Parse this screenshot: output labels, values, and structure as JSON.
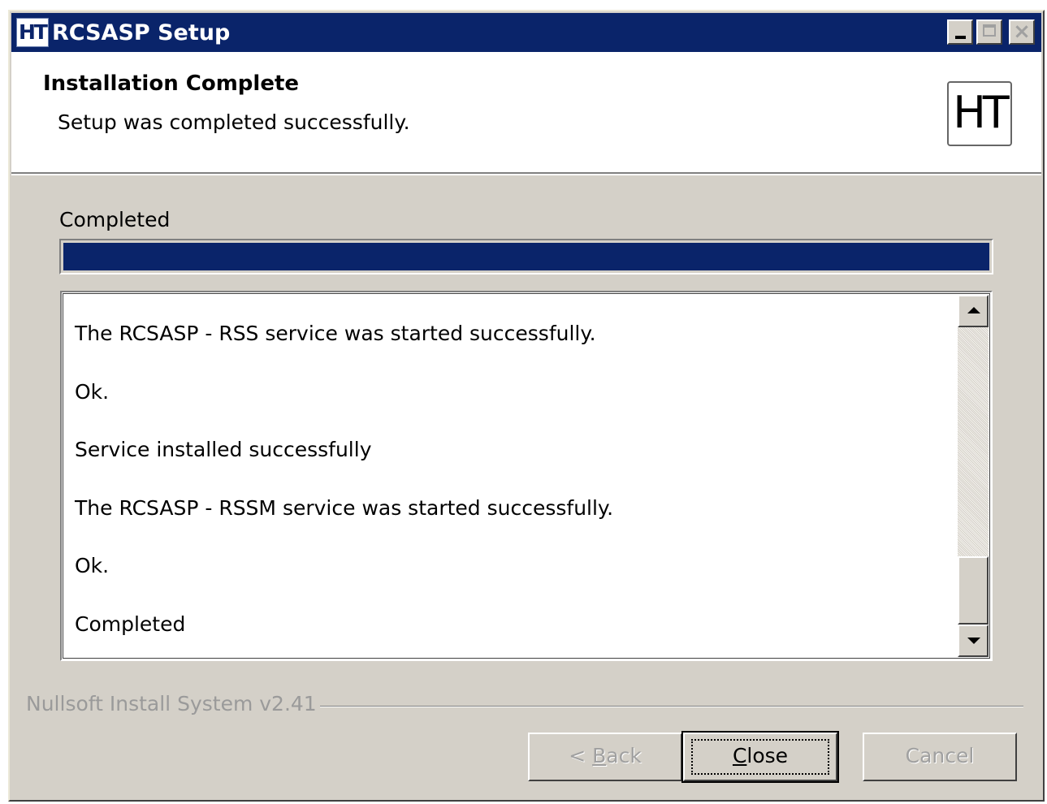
{
  "window": {
    "title": "RCSASP Setup",
    "icon_text": "HT",
    "controls": {
      "minimize": "minimize-icon",
      "maximize": "maximize-icon",
      "close": "close-icon"
    }
  },
  "header": {
    "title": "Installation Complete",
    "subtitle": "Setup was completed successfully.",
    "logo_text": "HT"
  },
  "status": {
    "label": "Completed",
    "progress_percent": 100,
    "progress_color": "#0a246a"
  },
  "log": {
    "lines": [
      "The RCSASP - RSS service was started successfully.",
      "Ok.",
      "Service installed successfully",
      "The RCSASP - RSSM service was started successfully.",
      "Ok.",
      "Completed"
    ]
  },
  "footer": {
    "branding": "Nullsoft Install System v2.41",
    "buttons": {
      "back": {
        "prefix": "< ",
        "mnemonic": "B",
        "rest": "ack",
        "enabled": false
      },
      "close": {
        "mnemonic": "C",
        "rest": "lose",
        "enabled": true
      },
      "cancel": {
        "label": "Cancel",
        "enabled": false
      }
    }
  },
  "colors": {
    "titlebar": "#0a246a",
    "dialog_face": "#d4d0c8",
    "disabled_text": "#a0a0a0"
  }
}
